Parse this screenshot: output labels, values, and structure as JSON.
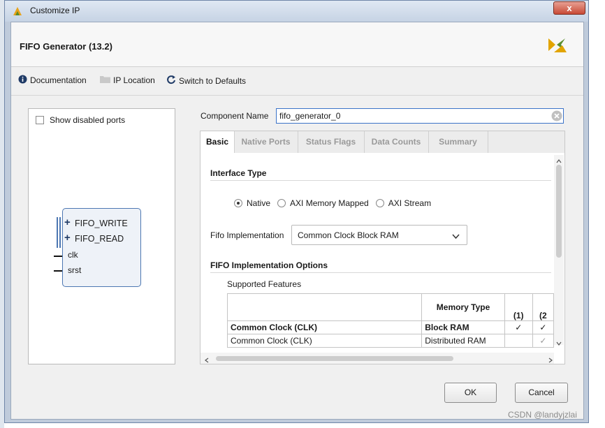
{
  "window": {
    "title": "Customize IP",
    "close_glyph": "x"
  },
  "header": {
    "ip_title": "FIFO Generator (13.2)",
    "logo_icon": "xilinx-logo"
  },
  "toolbar": {
    "documentation": "Documentation",
    "ip_location": "IP Location",
    "switch_defaults": "Switch to Defaults"
  },
  "left_panel": {
    "show_disabled_ports": "Show disabled ports",
    "ports": [
      "FIFO_WRITE",
      "FIFO_READ",
      "clk",
      "srst"
    ]
  },
  "component": {
    "label": "Component Name",
    "value": "fifo_generator_0"
  },
  "tabs": [
    "Basic",
    "Native Ports",
    "Status Flags",
    "Data Counts",
    "Summary"
  ],
  "active_tab": "Basic",
  "basic": {
    "interface_type_heading": "Interface Type",
    "interface_options": [
      "Native",
      "AXI Memory Mapped",
      "AXI Stream"
    ],
    "interface_selected": "Native",
    "fifo_impl_label": "Fifo Implementation",
    "fifo_impl_value": "Common Clock Block RAM",
    "impl_options_heading": "FIFO Implementation Options",
    "supported_features": "Supported Features",
    "table": {
      "col_memory_type": "Memory Type",
      "col_1": "(1)",
      "col_2": "(2",
      "rows": [
        {
          "name": "Common Clock (CLK)",
          "memory": "Block RAM",
          "c1": "✓",
          "c2": "✓",
          "bold": true
        },
        {
          "name": "Common Clock (CLK)",
          "memory": "Distributed RAM",
          "c1": "",
          "c2": "✓",
          "bold": false
        }
      ]
    }
  },
  "buttons": {
    "ok": "OK",
    "cancel": "Cancel"
  },
  "watermark": "CSDN @landyjzlai",
  "colors": {
    "accent": "#3b73c8",
    "ip_block_border": "#4d77b2",
    "logo": "#e2a400"
  }
}
